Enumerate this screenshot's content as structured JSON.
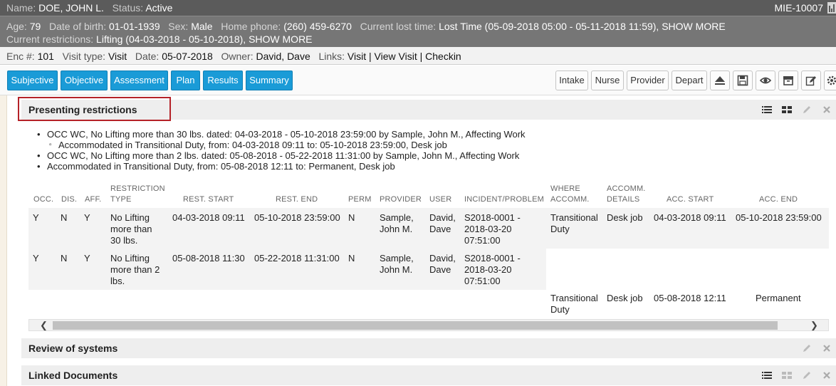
{
  "patient": {
    "name_label": "Name:",
    "name": "DOE, JOHN L.",
    "status_label": "Status:",
    "status": "Active",
    "mrn": "MIE-10007"
  },
  "details": {
    "age_label": "Age:",
    "age": "79",
    "dob_label": "Date of birth:",
    "dob": "01-01-1939",
    "sex_label": "Sex:",
    "sex": "Male",
    "phone_label": "Home phone:",
    "phone": "(260) 459-6270",
    "lost_label": "Current lost time:",
    "lost": "Lost Time (05-09-2018 05:00 - 05-11-2018 11:59),",
    "lost_more": "SHOW MORE",
    "restr_label": "Current restrictions:",
    "restr": "Lifting (04-03-2018 - 05-10-2018),",
    "restr_more": "SHOW MORE"
  },
  "encounter": {
    "enc_label": "Enc #:",
    "enc": "101",
    "type_label": "Visit type:",
    "type": "Visit",
    "date_label": "Date:",
    "date": "05-07-2018",
    "owner_label": "Owner:",
    "owner": "David, Dave",
    "links_label": "Links:",
    "link_visit": "Visit",
    "link_view": "View Visit",
    "link_checkin": "Checkin",
    "sep": "|"
  },
  "tabs": [
    "Subjective",
    "Objective",
    "Assessment",
    "Plan",
    "Results",
    "Summary"
  ],
  "right_buttons": [
    "Intake",
    "Nurse",
    "Provider",
    "Depart"
  ],
  "toolbar_icons": [
    "eject-icon",
    "save-icon",
    "eye-icon",
    "archive-icon",
    "edit-icon",
    "gear-icon"
  ],
  "sections": {
    "presenting": "Presenting restrictions",
    "review": "Review of systems",
    "linked": "Linked Documents"
  },
  "bullets": [
    "OCC WC, No Lifting more than 30 lbs. dated: 04-03-2018 - 05-10-2018 23:59:00 by Sample, John M., Affecting Work",
    "Accommodated in Transitional Duty, from: 04-03-2018 09:11 to: 05-10-2018 23:59:00, Desk job",
    "OCC WC, No Lifting more than 2 lbs. dated: 05-08-2018 - 05-22-2018 11:31:00 by Sample, John M., Affecting Work",
    "Accommodated in Transitional Duty, from: 05-08-2018 12:11 to: Permanent, Desk job"
  ],
  "table": {
    "headers": {
      "occ": "OCC.",
      "dis": "DIS.",
      "aff": "AFF.",
      "rtype1": "RESTRICTION",
      "rtype2": "TYPE",
      "rstart": "REST. START",
      "rend": "REST. END",
      "perm": "PERM",
      "provider": "PROVIDER",
      "user": "USER",
      "incident": "INCIDENT/PROBLEM",
      "where1": "WHERE",
      "where2": "ACCOMM.",
      "details1": "ACCOMM.",
      "details2": "DETAILS",
      "astart": "ACC. START",
      "aend": "ACC. END"
    },
    "rows": [
      {
        "occ": "Y",
        "dis": "N",
        "aff": "Y",
        "rtype": [
          "No Lifting",
          "more than",
          "30 lbs."
        ],
        "rstart": "04-03-2018 09:11",
        "rend": "05-10-2018 23:59:00",
        "perm": "N",
        "provider": [
          "Sample,",
          "John M."
        ],
        "user": [
          "David,",
          "Dave"
        ],
        "incident": [
          "S2018-0001 -",
          "2018-03-20",
          "07:51:00"
        ],
        "where": [
          "Transitional",
          "Duty"
        ],
        "details": "Desk job",
        "astart": "04-03-2018 09:11",
        "aend": "05-10-2018 23:59:00"
      },
      {
        "occ": "Y",
        "dis": "N",
        "aff": "Y",
        "rtype": [
          "No Lifting",
          "more than 2",
          "lbs."
        ],
        "rstart": "05-08-2018 11:30",
        "rend": "05-22-2018 11:31:00",
        "perm": "N",
        "provider": [
          "Sample,",
          "John M."
        ],
        "user": [
          "David,",
          "Dave"
        ],
        "incident": [
          "S2018-0001 -",
          "2018-03-20",
          "07:51:00"
        ]
      },
      {
        "where": [
          "Transitional",
          "Duty"
        ],
        "details": "Desk job",
        "astart": "05-08-2018 12:11",
        "aend": "Permanent"
      }
    ]
  },
  "colors": {
    "tab_blue": "#1a9bd7",
    "header_dark": "#5b5b5b",
    "header_mid": "#767676",
    "highlight_red": "#b52228"
  }
}
